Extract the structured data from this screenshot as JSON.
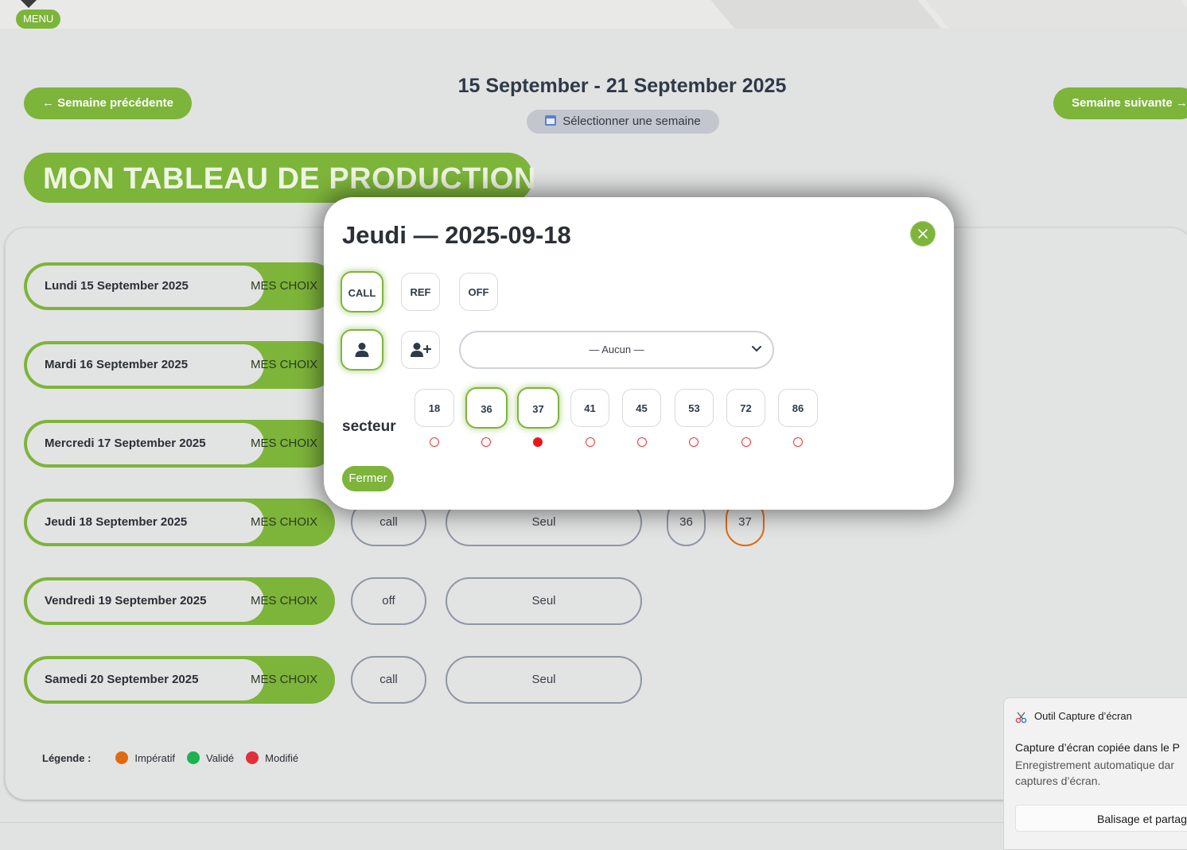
{
  "menu": {
    "label": "MENU"
  },
  "week": {
    "prev_label": "← Semaine précédente",
    "next_label": "Semaine suivante →",
    "title": "15 September - 21 September 2025",
    "select_label": "Sélectionner une semaine"
  },
  "banner": {
    "title": "MON TABLEAU DE PRODUCTION"
  },
  "days": [
    {
      "label": "Lundi 15 September 2025",
      "choix": "MES CHOIX"
    },
    {
      "label": "Mardi 16 September 2025",
      "choix": "MES CHOIX"
    },
    {
      "label": "Mercredi 17 September 2025",
      "choix": "MES CHOIX"
    },
    {
      "label": "Jeudi 18 September 2025",
      "choix": "MES CHOIX",
      "type": "call",
      "team": "Seul",
      "sectors": [
        "36",
        "37"
      ]
    },
    {
      "label": "Vendredi 19 September 2025",
      "choix": "MES CHOIX",
      "type": "off",
      "team": "Seul"
    },
    {
      "label": "Samedi 20 September 2025",
      "choix": "MES CHOIX",
      "type": "call",
      "team": "Seul"
    }
  ],
  "legend": {
    "title": "Légende :",
    "items": [
      {
        "label": "Impératif",
        "color": "#e06a12"
      },
      {
        "label": "Validé",
        "color": "#1cb24f"
      },
      {
        "label": "Modifié",
        "color": "#e0303a"
      }
    ]
  },
  "modal": {
    "title": "Jeudi — 2025-09-18",
    "types": [
      {
        "label": "CALL",
        "selected": true
      },
      {
        "label": "REF",
        "selected": false
      },
      {
        "label": "OFF",
        "selected": false
      }
    ],
    "team_modes": [
      {
        "icon": "user-icon",
        "selected": true
      },
      {
        "icon": "user-plus-icon",
        "selected": false
      }
    ],
    "partner_select": {
      "value": "— Aucun —"
    },
    "secteur_label": "secteur",
    "sectors": [
      {
        "label": "18",
        "selected": false,
        "checked": false
      },
      {
        "label": "36",
        "selected": true,
        "checked": false
      },
      {
        "label": "37",
        "selected": true,
        "checked": true
      },
      {
        "label": "41",
        "selected": false,
        "checked": false
      },
      {
        "label": "45",
        "selected": false,
        "checked": false
      },
      {
        "label": "53",
        "selected": false,
        "checked": false
      },
      {
        "label": "72",
        "selected": false,
        "checked": false
      },
      {
        "label": "86",
        "selected": false,
        "checked": false
      }
    ],
    "close_label": "Fermer"
  },
  "toast": {
    "app_name": "Outil Capture d’écran",
    "heading": "Capture d’écran copiée dans le P",
    "body": "Enregistrement automatique dar captures d’écran.",
    "action": "Balisage et partag"
  },
  "colors": {
    "accent": "#7db43a",
    "imperatif": "#e06a12",
    "valide": "#1cb24f",
    "modifie": "#e0303a"
  }
}
